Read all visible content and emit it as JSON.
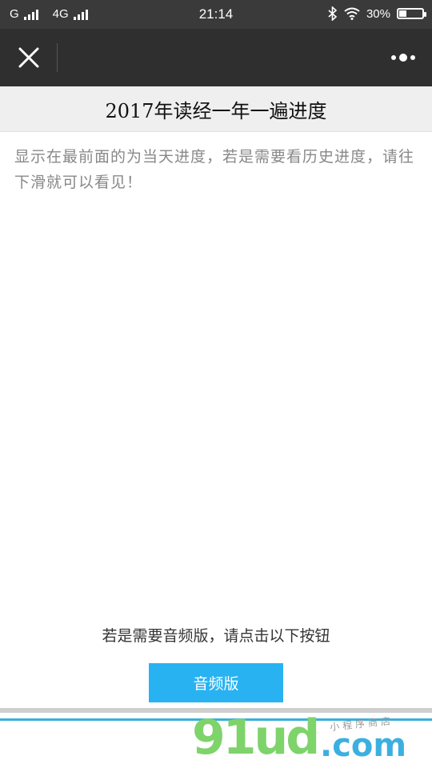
{
  "status_bar": {
    "carrier1": "G",
    "carrier2": "4G",
    "time": "21:14",
    "battery_percent_label": "30%",
    "battery_level": 0.3
  },
  "page": {
    "title": "2017年读经一年一遍进度",
    "intro": "显示在最前面的为当天进度，若是需要看历史进度，请往下滑就可以看见！",
    "audio_prompt": "若是需要音频版，请点击以下按钮",
    "audio_button_label": "音频版"
  },
  "watermark": {
    "main": "91ud",
    "suffix": ".com",
    "sub": "小程序商店"
  },
  "colors": {
    "accent": "#29b2f1",
    "nav_bg": "#2f2f2f",
    "watermark_green": "#7ed36b",
    "watermark_blue": "#3bb0e0"
  },
  "icons": {
    "close": "close-icon",
    "more": "more-dots-icon",
    "bluetooth": "bluetooth-icon",
    "wifi": "wifi-icon"
  }
}
